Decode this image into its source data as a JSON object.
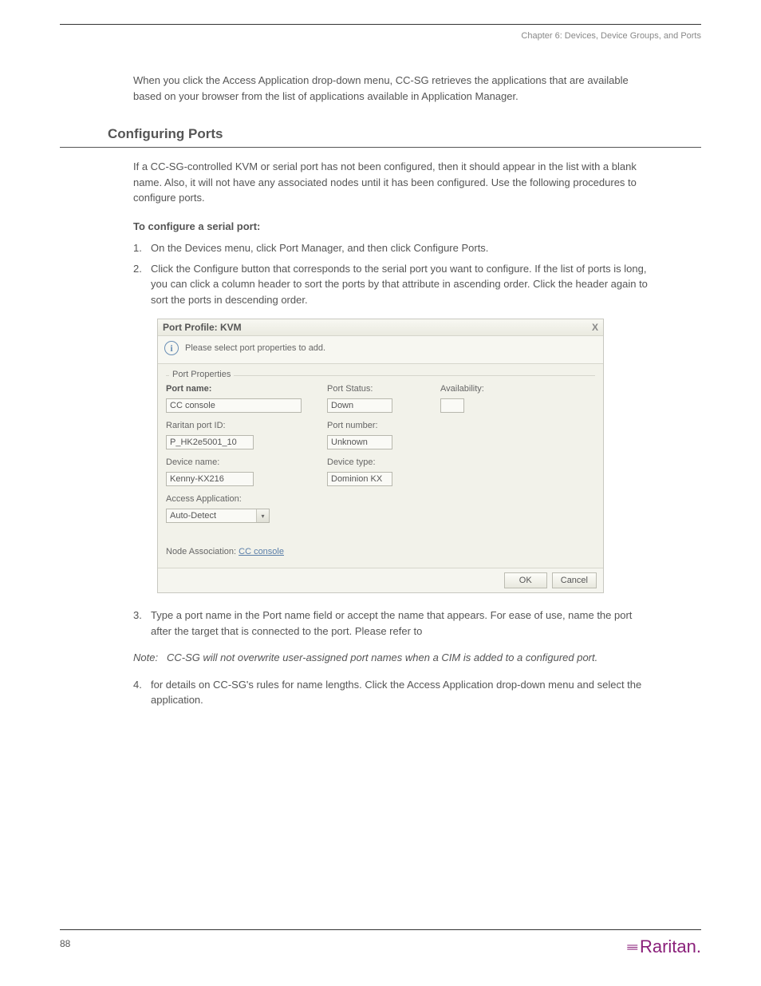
{
  "header": "Chapter 6: Devices, Device Groups, and Ports",
  "section_title": "Configuring Ports",
  "para_intro_1": "When you click the Access Application drop-down menu, CC-SG retrieves the applications that are available based on your browser from the list of applications available in Application Manager.",
  "para_intro_2": "If a CC-SG-controlled KVM or serial port has not been configured, then it should appear in the list with a blank name. Also, it will not have any associated nodes until it has been configured. Use the following procedures to configure ports.",
  "steps_intro": "To configure a serial port:",
  "steps": [
    "On the Devices menu, click Port Manager, and then click Configure Ports.",
    "Click the Configure button that corresponds to the serial port you want to configure. If the list of ports is long, you can click a column header to sort the ports by that attribute in ascending order. Click the header again to sort the ports in descending order."
  ],
  "dialog": {
    "title": "Port Profile: KVM",
    "close_glyph": "X",
    "message": "Please select port properties to add.",
    "fieldset_label": "Port Properties",
    "labels": {
      "port_name": "Port name:",
      "raritan_port_id": "Raritan port ID:",
      "device_name": "Device name:",
      "access_app": "Access Application:",
      "port_status": "Port Status:",
      "port_number": "Port number:",
      "device_type": "Device type:",
      "availability": "Availability:",
      "node_assoc": "Node Association:"
    },
    "values": {
      "port_name": "CC console",
      "raritan_port_id": "P_HK2e5001_10",
      "device_name": "Kenny-KX216",
      "access_app": "Auto-Detect",
      "port_status": "Down",
      "port_number": "Unknown",
      "device_type": "Dominion KX",
      "availability": "",
      "node_assoc_link": "CC console"
    },
    "buttons": {
      "ok": "OK",
      "cancel": "Cancel"
    }
  },
  "post_steps": [
    "Type a port name in the Port name field or accept the name that appears. For ease of use, name the port after the target that is connected to the port. Please refer to",
    "for details on CC-SG's rules for name lengths. Click the Access Application drop-down menu and select the application."
  ],
  "note_label": "Note:",
  "note_text": "CC-SG will not overwrite user-assigned port names when a CIM is added to a configured port.",
  "page_number": "88",
  "brand": "Raritan."
}
